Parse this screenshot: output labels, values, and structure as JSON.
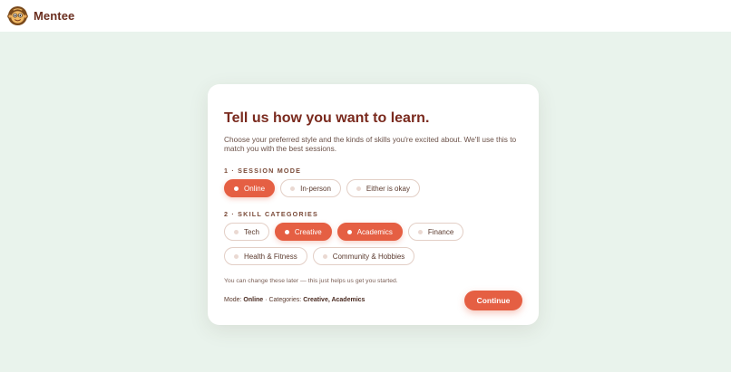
{
  "app": {
    "name": "Mentee",
    "logo_icon": "monkey-icon"
  },
  "colors": {
    "accent": "#e55f43",
    "background": "#e9f3ec",
    "title": "#7a2a1e"
  },
  "card": {
    "title": "Tell us how you want to learn.",
    "description": "Choose your preferred style and the kinds of skills you're excited about. We'll use this to match you with the best sessions.",
    "session_mode": {
      "label": "1 · SESSION MODE",
      "options": [
        {
          "label": "Online",
          "selected": true
        },
        {
          "label": "In-person",
          "selected": false
        },
        {
          "label": "Either is okay",
          "selected": false
        }
      ]
    },
    "skill_categories": {
      "label": "2 · SKILL CATEGORIES",
      "options": [
        {
          "label": "Tech",
          "selected": false
        },
        {
          "label": "Creative",
          "selected": true
        },
        {
          "label": "Academics",
          "selected": true
        },
        {
          "label": "Finance",
          "selected": false
        },
        {
          "label": "Health & Fitness",
          "selected": false
        },
        {
          "label": "Community & Hobbies",
          "selected": false
        }
      ]
    },
    "note": "You can change these later — this just helps us get you started.",
    "summary": {
      "mode_label": "Mode:",
      "mode_value": "Online",
      "separator": "·",
      "categories_label": "Categories:",
      "categories_value": "Creative, Academics"
    },
    "continue_label": "Continue"
  }
}
